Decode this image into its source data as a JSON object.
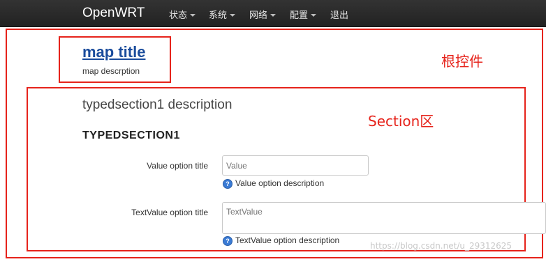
{
  "header": {
    "brand": "OpenWRT",
    "menu": [
      {
        "label": "状态",
        "dropdown": true
      },
      {
        "label": "系统",
        "dropdown": true
      },
      {
        "label": "网络",
        "dropdown": true
      },
      {
        "label": "配置",
        "dropdown": true
      },
      {
        "label": "退出",
        "dropdown": false
      }
    ]
  },
  "annotations": {
    "root_label": "根控件",
    "section_label": "Section区",
    "color": "#e6231b"
  },
  "map": {
    "title": "map title",
    "description": "map descrption"
  },
  "section": {
    "description": "typedsection1 description",
    "title": "TYPEDSECTION1",
    "options": [
      {
        "label": "Value option title",
        "placeholder": "Value",
        "help": "Value option description",
        "help_icon": "info-icon"
      },
      {
        "label": "TextValue option title",
        "placeholder": "TextValue",
        "help": "TextValue option description",
        "help_icon": "info-icon"
      }
    ]
  },
  "watermark": "https://blog.csdn.net/u_29312625"
}
